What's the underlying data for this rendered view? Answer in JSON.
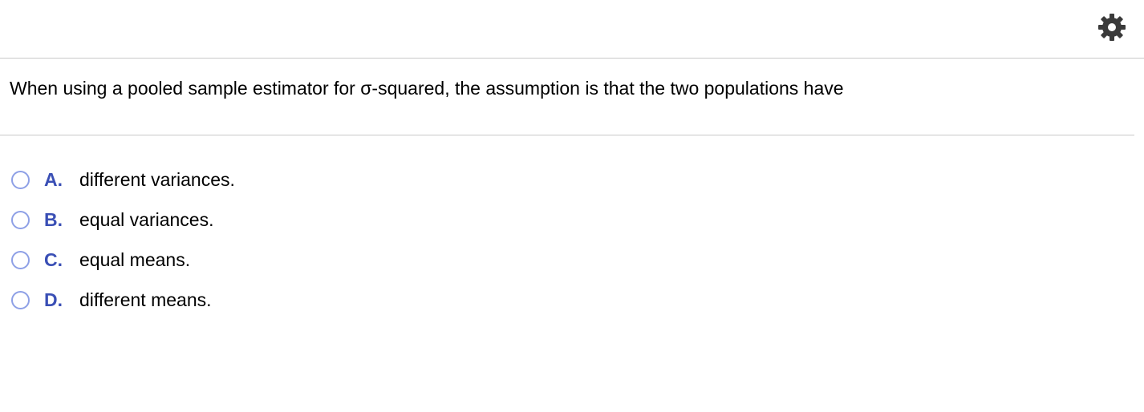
{
  "header": {
    "settings_icon": "gear-icon"
  },
  "question": {
    "text": "When using a pooled sample estimator for σ-squared, the assumption is that the two populations have"
  },
  "options": [
    {
      "letter": "A.",
      "text": "different variances."
    },
    {
      "letter": "B.",
      "text": "equal variances."
    },
    {
      "letter": "C.",
      "text": "equal means."
    },
    {
      "letter": "D.",
      "text": "different means."
    }
  ],
  "colors": {
    "accent": "#3a4fb5",
    "radio_border": "#8ea0e6",
    "divider": "#c9c9c9",
    "icon": "#3a3a3a"
  }
}
